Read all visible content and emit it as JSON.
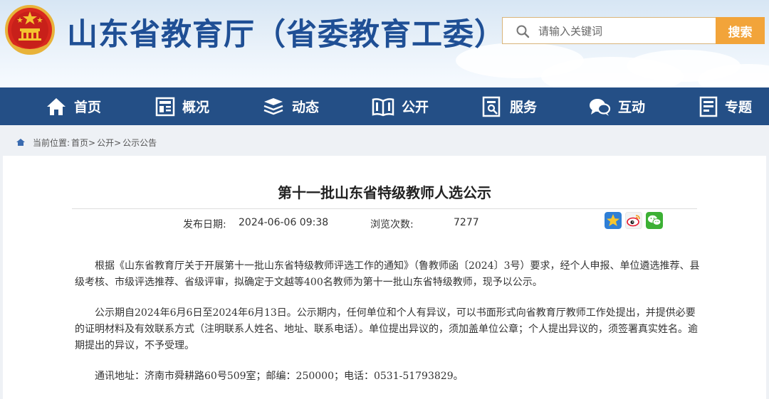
{
  "header": {
    "site_title": "山东省教育厅（省委教育工委）",
    "search_placeholder": "请输入关键词",
    "search_button": "搜索"
  },
  "nav": {
    "items": [
      {
        "label": "首页",
        "icon": "home-icon"
      },
      {
        "label": "概况",
        "icon": "overview-icon"
      },
      {
        "label": "动态",
        "icon": "news-icon"
      },
      {
        "label": "公开",
        "icon": "book-icon"
      },
      {
        "label": "服务",
        "icon": "service-icon"
      },
      {
        "label": "互动",
        "icon": "chat-icon"
      },
      {
        "label": "专题",
        "icon": "topic-icon"
      }
    ]
  },
  "breadcrumb": {
    "prefix": "当前位置:",
    "items": [
      "首页>",
      "公开>",
      "公示公告"
    ]
  },
  "article": {
    "title": "第十一批山东省特级教师人选公示",
    "publish_label": "发布日期:",
    "publish_date": "2024-06-06 09:38",
    "views_label": "浏览次数:",
    "views_count": "7277",
    "share_icons": [
      "qzone-icon",
      "weibo-icon",
      "wechat-icon"
    ],
    "paragraphs": [
      "根据《山东省教育厅关于开展第十一批山东省特级教师评选工作的通知》（鲁教师函〔2024〕3号）要求，经个人申报、单位遴选推荐、县级考核、市级评选推荐、省级评审，拟确定于文越等400名教师为第十一批山东省特级教师，现予以公示。",
      "公示期自2024年6月6日至2024年6月13日。公示期内，任何单位和个人有异议，可以书面形式向省教育厅教师工作处提出，并提供必要的证明材料及有效联系方式（注明联系人姓名、地址、联系电话）。单位提出异议的，须加盖单位公章；个人提出异议的，须签署真实姓名。逾期提出的异议，不予受理。",
      "通讯地址：济南市舜耕路60号509室；邮编：250000；电话：0531-51793829。"
    ]
  },
  "colors": {
    "brand_blue": "#1f4f95",
    "nav_bg": "#244f86",
    "search_button": "#f2a43a"
  }
}
